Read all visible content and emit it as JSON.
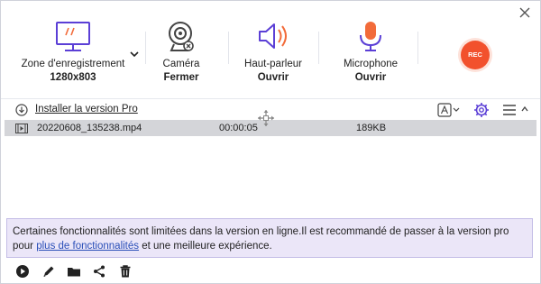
{
  "toolbar": {
    "tools": [
      {
        "icon": "monitor-icon",
        "label": "Zone d'enregistrement",
        "sub": "1280x803"
      },
      {
        "icon": "webcam-icon",
        "label": "Caméra",
        "sub": "Fermer"
      },
      {
        "icon": "speaker-icon",
        "label": "Haut-parleur",
        "sub": "Ouvrir"
      },
      {
        "icon": "microphone-icon",
        "label": "Microphone",
        "sub": "Ouvrir"
      }
    ],
    "rec_label": "REC"
  },
  "install": {
    "text": "Installer la version Pro"
  },
  "files": [
    {
      "name": "20220608_135238.mp4",
      "duration": "00:00:05",
      "size": "189KB"
    }
  ],
  "banner": {
    "text_part1": "Certaines fonctionnalités sont limitées dans la version en ligne.Il est recommandé de passer à la version pro pour ",
    "link": "plus de fonctionnalités",
    "text_part2": " et une meilleure expérience."
  },
  "colors": {
    "accent": "#5b3fd6",
    "rec": "#f2512d",
    "speaker_accent": "#f26b3a",
    "mic_accent": "#f26b3a",
    "banner_bg": "#ebe6f8"
  }
}
